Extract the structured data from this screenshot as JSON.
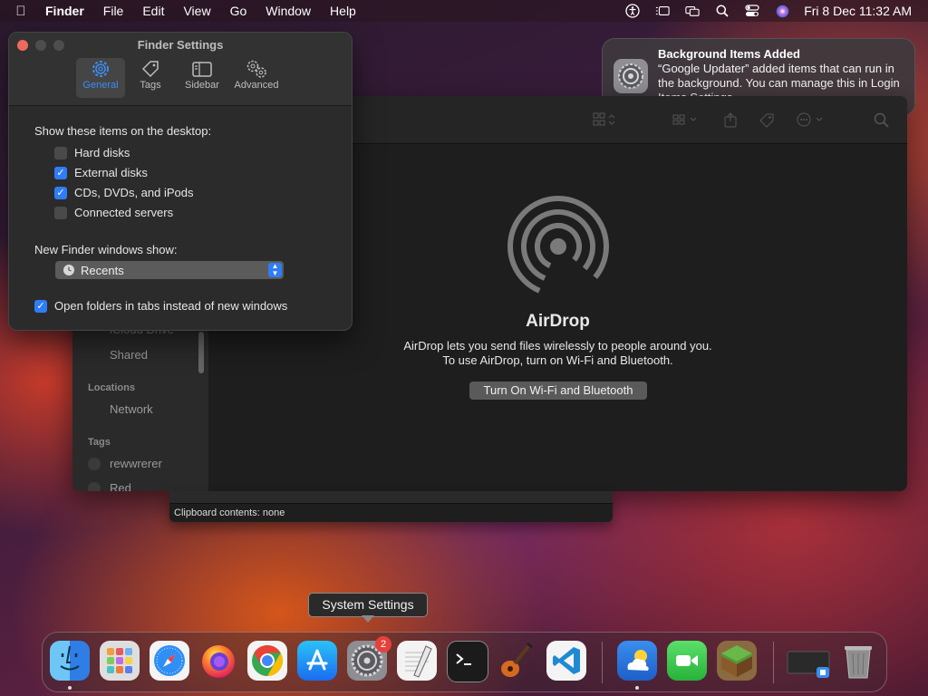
{
  "menubar": {
    "app_name": "Finder",
    "items": [
      "File",
      "Edit",
      "View",
      "Go",
      "Window",
      "Help"
    ],
    "clock": "Fri 8 Dec  11:32 AM"
  },
  "settings": {
    "title": "Finder Settings",
    "tabs": [
      "General",
      "Tags",
      "Sidebar",
      "Advanced"
    ],
    "desktop_label": "Show these items on the desktop:",
    "desktop_items": [
      {
        "label": "Hard disks",
        "checked": false
      },
      {
        "label": "External disks",
        "checked": true
      },
      {
        "label": "CDs, DVDs, and iPods",
        "checked": true
      },
      {
        "label": "Connected servers",
        "checked": false
      }
    ],
    "new_window_label": "New Finder windows show:",
    "new_window_value": "Recents",
    "open_in_tabs_label": "Open folders in tabs instead of new windows",
    "open_in_tabs_checked": true
  },
  "finder": {
    "sidebar": {
      "partial_item": "iCloud Drive",
      "shared": "Shared",
      "locations_header": "Locations",
      "network": "Network",
      "tags_header": "Tags",
      "tag1": "rewwrerer",
      "tag2": "Red"
    },
    "airdrop": {
      "title": "AirDrop",
      "line1": "AirDrop lets you send files wirelessly to people around you.",
      "line2": "To use AirDrop, turn on Wi-Fi and Bluetooth.",
      "button": "Turn On Wi-Fi and Bluetooth"
    }
  },
  "clipboard": {
    "status": "Clipboard contents: none"
  },
  "notification": {
    "title": "Background Items Added",
    "body": "“Google Updater” added items that can run in the background. You can manage this in Login Items Settings."
  },
  "tooltip": "System Settings",
  "dock": {
    "settings_badge": "2",
    "apps": [
      "finder-icon",
      "launchpad-icon",
      "safari-icon",
      "firefox-icon",
      "chrome-icon",
      "app-store-icon",
      "system-settings-icon",
      "textedit-icon",
      "terminal-icon",
      "garageband-icon",
      "vscode-icon",
      "weather-icon",
      "facetime-icon",
      "minecraft-icon",
      "preview-icon",
      "trash-icon"
    ]
  }
}
